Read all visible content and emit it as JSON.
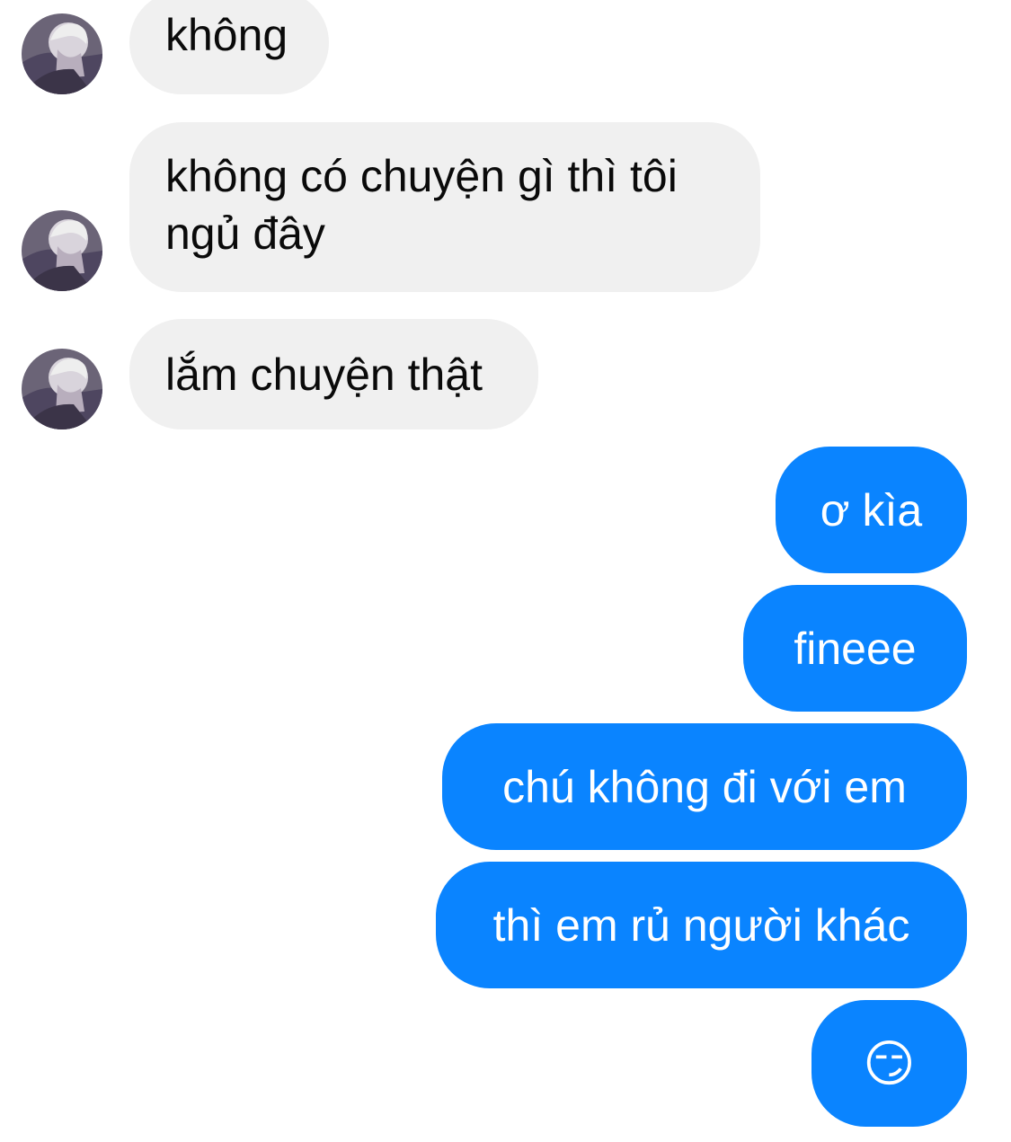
{
  "messages": [
    {
      "sender": "other",
      "text": "không"
    },
    {
      "sender": "other",
      "text": "không có chuyện gì thì tôi ngủ đây"
    },
    {
      "sender": "other",
      "text": "lắm chuyện thật"
    },
    {
      "sender": "me",
      "text": "ơ kìa"
    },
    {
      "sender": "me",
      "text": "fineee"
    },
    {
      "sender": "me",
      "text": "chú không đi với em"
    },
    {
      "sender": "me",
      "text": "thì em rủ người khác"
    },
    {
      "sender": "me",
      "text": "😏"
    }
  ],
  "colors": {
    "incoming_bubble": "#f0f0f0",
    "outgoing_bubble": "#0a84ff",
    "incoming_text": "#0a0a0a",
    "outgoing_text": "#ffffff"
  },
  "icons": {
    "avatar": "contact-avatar-icon"
  }
}
